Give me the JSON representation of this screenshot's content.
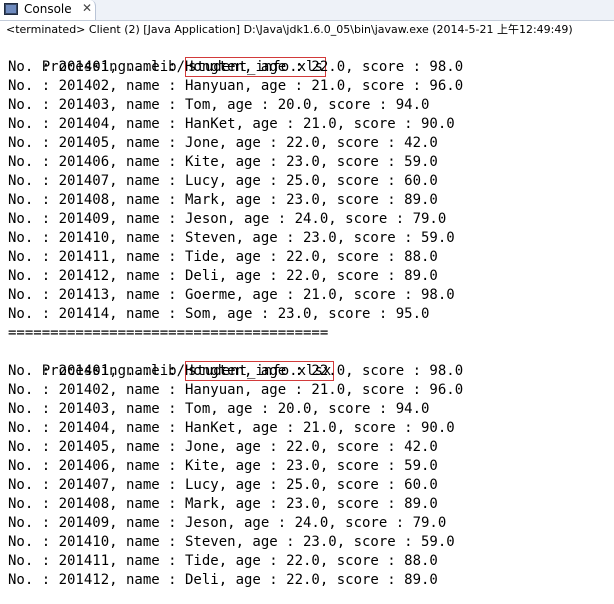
{
  "tab": {
    "label": "Console",
    "close": "✕"
  },
  "status": "<terminated> Client (2) [Java Application] D:\\Java\\jdk1.6.0_05\\bin\\javaw.exe (2014-5-21 上午12:49:49)",
  "console": {
    "block1": {
      "prefix": "Processing...lib/",
      "file": "student_info.xls",
      "rows": [
        "No. : 201401, name : Hongten, age : 22.0, score : 98.0",
        "No. : 201402, name : Hanyuan, age : 21.0, score : 96.0",
        "No. : 201403, name : Tom, age : 20.0, score : 94.0",
        "No. : 201404, name : HanKet, age : 21.0, score : 90.0",
        "No. : 201405, name : Jone, age : 22.0, score : 42.0",
        "No. : 201406, name : Kite, age : 23.0, score : 59.0",
        "No. : 201407, name : Lucy, age : 25.0, score : 60.0",
        "No. : 201408, name : Mark, age : 23.0, score : 89.0",
        "No. : 201409, name : Jeson, age : 24.0, score : 79.0",
        "No. : 201410, name : Steven, age : 23.0, score : 59.0",
        "No. : 201411, name : Tide, age : 22.0, score : 88.0",
        "No. : 201412, name : Deli, age : 22.0, score : 89.0",
        "No. : 201413, name : Goerme, age : 21.0, score : 98.0",
        "No. : 201414, name : Som, age : 23.0, score : 95.0"
      ]
    },
    "separator": "======================================",
    "block2": {
      "prefix": "Processing...lib/",
      "file": "student_info.xlsx",
      "rows": [
        "No. : 201401, name : Hongten, age : 22.0, score : 98.0",
        "No. : 201402, name : Hanyuan, age : 21.0, score : 96.0",
        "No. : 201403, name : Tom, age : 20.0, score : 94.0",
        "No. : 201404, name : HanKet, age : 21.0, score : 90.0",
        "No. : 201405, name : Jone, age : 22.0, score : 42.0",
        "No. : 201406, name : Kite, age : 23.0, score : 59.0",
        "No. : 201407, name : Lucy, age : 25.0, score : 60.0",
        "No. : 201408, name : Mark, age : 23.0, score : 89.0",
        "No. : 201409, name : Jeson, age : 24.0, score : 79.0",
        "No. : 201410, name : Steven, age : 23.0, score : 59.0",
        "No. : 201411, name : Tide, age : 22.0, score : 88.0",
        "No. : 201412, name : Deli, age : 22.0, score : 89.0"
      ]
    }
  }
}
